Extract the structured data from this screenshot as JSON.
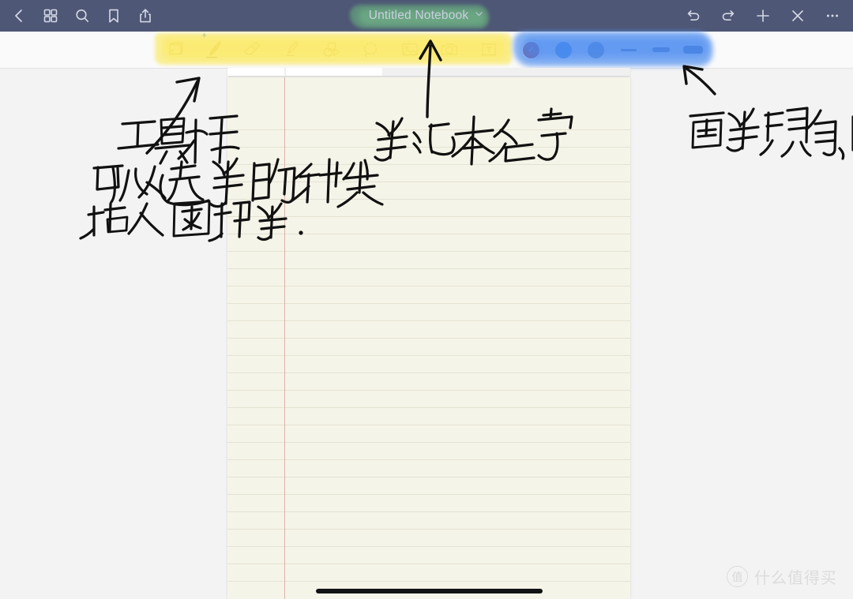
{
  "app": {
    "accent_navbar": "#4e5775",
    "page_color": "#f5f4e8",
    "margin_line_color": "#d9b3ab"
  },
  "topbar": {
    "title": "Untitled Notebook",
    "title_chevron": "chevron-down-icon",
    "title_highlight_color": "#68b07e",
    "left_icons": [
      {
        "name": "back-icon",
        "label": "Back"
      },
      {
        "name": "grid-icon",
        "label": "Page Grid"
      },
      {
        "name": "search-icon",
        "label": "Search"
      },
      {
        "name": "bookmark-icon",
        "label": "Bookmark"
      },
      {
        "name": "share-icon",
        "label": "Share"
      }
    ],
    "right_icons": [
      {
        "name": "undo-icon",
        "label": "Undo"
      },
      {
        "name": "redo-icon",
        "label": "Redo"
      },
      {
        "name": "add-icon",
        "label": "Add"
      },
      {
        "name": "close-icon",
        "label": "Close"
      },
      {
        "name": "more-icon",
        "label": "More"
      }
    ]
  },
  "toolbar": {
    "highlight_color": "#faec78",
    "tools": [
      {
        "name": "page-layers-icon",
        "label": "Page",
        "selected": false
      },
      {
        "name": "pen-icon",
        "label": "Pen",
        "selected": true,
        "badge": "pencil-sparkle-icon"
      },
      {
        "name": "eraser-icon",
        "label": "Eraser",
        "selected": false
      },
      {
        "name": "highlighter-icon",
        "label": "Highlighter",
        "selected": false
      },
      {
        "name": "shapes-icon",
        "label": "Shapes",
        "selected": false
      },
      {
        "name": "lasso-icon",
        "label": "Lasso",
        "selected": false
      },
      {
        "name": "image-icon",
        "label": "Image",
        "selected": false
      },
      {
        "name": "camera-icon",
        "label": "Camera",
        "selected": false
      },
      {
        "name": "textbox-icon",
        "label": "Text Box",
        "selected": false
      }
    ]
  },
  "style_group": {
    "highlight_color": "#5a96f0",
    "colors": [
      {
        "name": "color-swatch-red",
        "hex": "#9e1f28",
        "selected": true
      },
      {
        "name": "color-swatch-blue",
        "hex": "#2f7de0",
        "selected": false
      },
      {
        "name": "color-swatch-gray",
        "hex": "#5f7fae",
        "selected": false
      }
    ],
    "widths": [
      {
        "name": "stroke-width-thin",
        "size": "thin",
        "selected": false
      },
      {
        "name": "stroke-width-medium",
        "size": "medium",
        "selected": false
      },
      {
        "name": "stroke-width-thick",
        "size": "thick",
        "selected": true
      }
    ]
  },
  "page": {
    "rule_count": 27,
    "rule_spacing": 22,
    "home_indicator": true
  },
  "annotations": [
    {
      "name": "annotation-toolbar",
      "lines": [
        "工具栏",
        "可以选笔的种类",
        "插入图片等."
      ],
      "arrow": "arrow-up-right"
    },
    {
      "name": "annotation-notebook-name",
      "lines": [
        "笔记本名字"
      ],
      "arrow": "arrow-up"
    },
    {
      "name": "annotation-brush-style",
      "lines": [
        "画笔颜色,粗细"
      ],
      "arrow": "arrow-up-left"
    }
  ],
  "watermark": {
    "badge": "值",
    "text": "什么值得买"
  }
}
